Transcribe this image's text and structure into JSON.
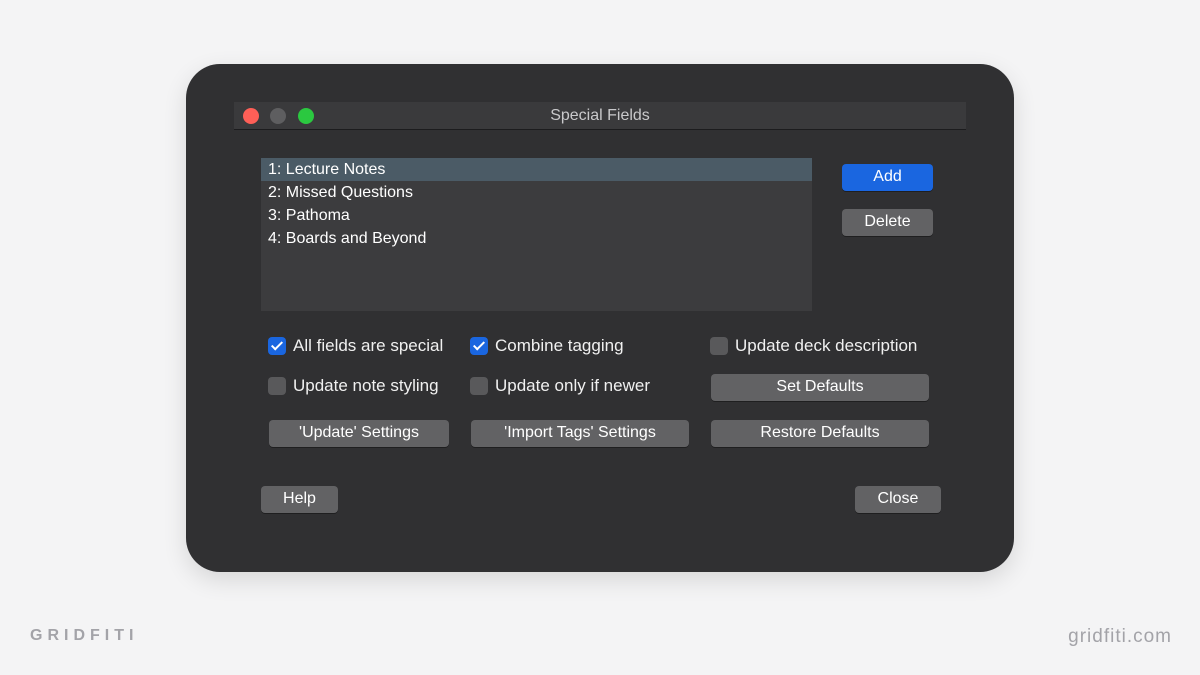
{
  "dialog": {
    "title": "Special Fields",
    "list_items": [
      "1: Lecture Notes",
      "2: Missed Questions",
      "3: Pathoma",
      "4: Boards and Beyond"
    ],
    "selected_index": 0,
    "buttons": {
      "add": "Add",
      "delete": "Delete",
      "set_defaults": "Set Defaults",
      "update_settings": "'Update' Settings",
      "import_tags_settings": "'Import Tags' Settings",
      "restore_defaults": "Restore Defaults",
      "help": "Help",
      "close": "Close"
    },
    "checkboxes": {
      "all_fields_special": {
        "label": "All fields are special",
        "checked": true
      },
      "combine_tagging": {
        "label": "Combine tagging",
        "checked": true
      },
      "update_deck_description": {
        "label": "Update deck description",
        "checked": false
      },
      "update_note_styling": {
        "label": "Update note styling",
        "checked": false
      },
      "update_only_if_newer": {
        "label": "Update only if newer",
        "checked": false
      }
    }
  },
  "branding": {
    "left": "GRIDFITI",
    "right": "gridfiti.com"
  },
  "colors": {
    "background": "#f4f4f5",
    "dialog": "#303032",
    "accent": "#1a66e0"
  }
}
